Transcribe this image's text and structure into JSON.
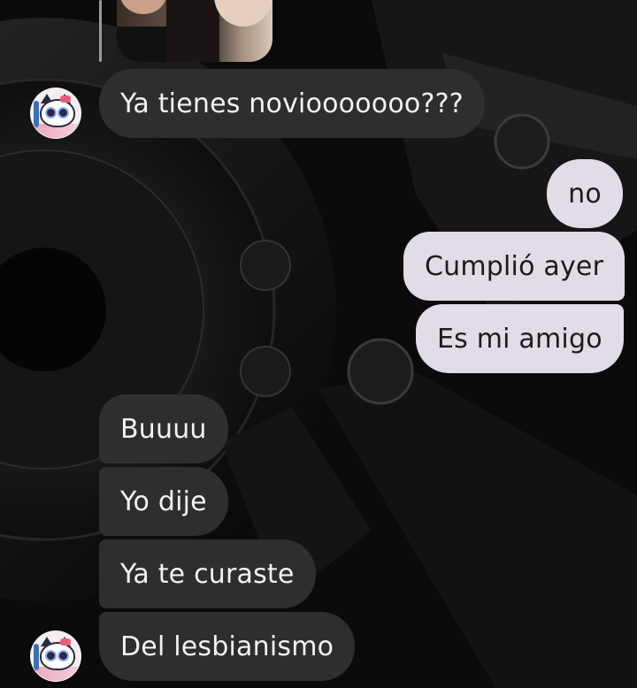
{
  "conversation": {
    "messages": [
      {
        "sender": "them",
        "text": "Ya tienes noviooooooo???"
      },
      {
        "sender": "me",
        "text": "no"
      },
      {
        "sender": "me",
        "text": "Cumplió ayer"
      },
      {
        "sender": "me",
        "text": "Es mi amigo"
      },
      {
        "sender": "them",
        "text": "Buuuu"
      },
      {
        "sender": "them",
        "text": "Yo dije"
      },
      {
        "sender": "them",
        "text": "Ya te curaste"
      },
      {
        "sender": "them",
        "text": "Del lesbianismo"
      }
    ]
  },
  "colors": {
    "incoming_bubble": "#2e2e2e",
    "outgoing_bubble": "#e1dce6",
    "background": "#0b0b0b"
  },
  "icons": {
    "contact_avatar": "cat-avatar-icon",
    "reply_preview": "photo-thumbnail"
  }
}
